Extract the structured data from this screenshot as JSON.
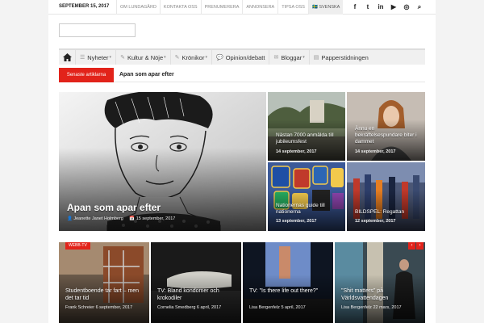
{
  "topbar": {
    "date": "SEPTEMBER 15, 2017",
    "links": [
      "OM LUNDAGÅRD",
      "KONTAKTA OSS",
      "PRENUMERERA",
      "ANNONSERA",
      "TIPSA OSS"
    ],
    "language": "🇸🇪 SVENSKA",
    "social_icons": [
      "facebook-icon",
      "twitter-icon",
      "linkedin-icon",
      "youtube-icon",
      "instagram-icon",
      "search-icon"
    ],
    "social_glyphs": [
      "f",
      "t",
      "in",
      "▶",
      "◎",
      "⌕"
    ]
  },
  "nav": {
    "items": [
      {
        "icon": "☰",
        "label": "Nyheter",
        "caret": "▾"
      },
      {
        "icon": "✎",
        "label": "Kultur & Nöje",
        "caret": "▾"
      },
      {
        "icon": "✎",
        "label": "Krönikor",
        "caret": "▾"
      },
      {
        "icon": "💬",
        "label": "Opinion/debatt",
        "caret": ""
      },
      {
        "icon": "✉",
        "label": "Bloggar",
        "caret": "▾"
      },
      {
        "icon": "▤",
        "label": "Papperstidningen",
        "caret": ""
      }
    ]
  },
  "ticker": {
    "label": "Senaste artiklarna",
    "headline": "Apan som apar efter"
  },
  "hero": {
    "title": "Apan som apar efter",
    "author": "👤 Jeanette Janet Holmberg",
    "date": "📅 15 september, 2017"
  },
  "side_tiles": [
    {
      "title": "Nästan 7000 anmälda till jubileumsfest",
      "date": "14 september, 2017"
    },
    {
      "title": "Ännu en bekräftelsespundare biter i dammet",
      "date": "14 september, 2017"
    },
    {
      "title": "Nationernas guide till nationerna",
      "date": "13 september, 2017"
    },
    {
      "title": "BILDSPEL: Regattan",
      "date": "12 september, 2017"
    }
  ],
  "webb_tv": {
    "label": "WEBB-TV",
    "prev": "‹",
    "next": "›",
    "videos": [
      {
        "title": "Studentboende tar fart – men det tar tid",
        "meta": "Frank Schreier 6 september, 2017"
      },
      {
        "title": "TV: Bland kondomer och krokodiler",
        "meta": "Cornelia Smedberg 6 april, 2017"
      },
      {
        "title": "TV: \"Is there life out there?\"",
        "meta": "Lisa Bergenfelz 5 april, 2017"
      },
      {
        "title": "\"Shit matters\" på Världsvattendagen",
        "meta": "Lisa Bergenfelz 22 mars, 2017"
      }
    ]
  },
  "colors": {
    "accent": "#e2231a",
    "nav_bg": "#f0f0f0"
  }
}
